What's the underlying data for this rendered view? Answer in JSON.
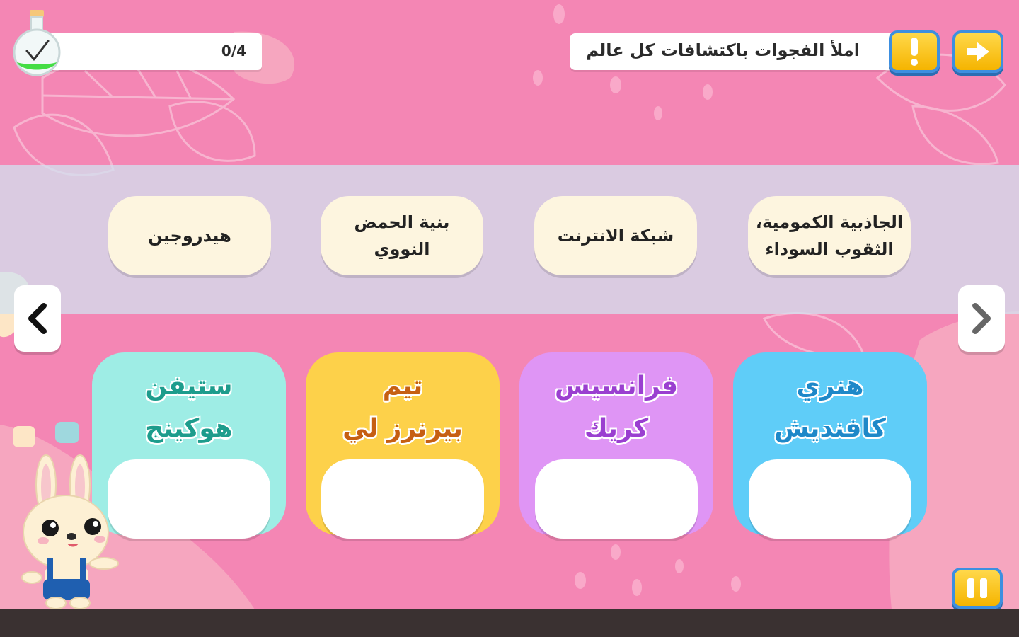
{
  "progress": {
    "text": "0/4",
    "fraction": 0
  },
  "instruction": {
    "text": "املأ الفجوات باكتشافات كل عالم"
  },
  "buttons": {
    "hint_icon": "exclamation-icon",
    "next_icon": "arrow-right-icon",
    "pause_icon": "pause-icon"
  },
  "answers": [
    {
      "label": "الجاذبية الكمومية، الثقوب السوداء"
    },
    {
      "label": "شبكة الانترنت"
    },
    {
      "label": "بنية الحمض النووي"
    },
    {
      "label": "هيدروجين"
    }
  ],
  "scientists": [
    {
      "name_line1": "هنري",
      "name_line2": "كافنديش",
      "color": "#5fcdf8",
      "text_color": "#1e88c8"
    },
    {
      "name_line1": "فرانسيس",
      "name_line2": "كريك",
      "color": "#df95f5",
      "text_color": "#9a3fd0"
    },
    {
      "name_line1": "تيم",
      "name_line2": "بيرنرز لي",
      "color": "#fdd14a",
      "text_color": "#c65f12"
    },
    {
      "name_line1": "ستيفن",
      "name_line2": "هوكينج",
      "color": "#9eede5",
      "text_color": "#1d9c8c"
    }
  ],
  "colors": {
    "background": "#f486b4",
    "accent_yellow": "#f5b400",
    "accent_blue": "#3d8fe0"
  }
}
